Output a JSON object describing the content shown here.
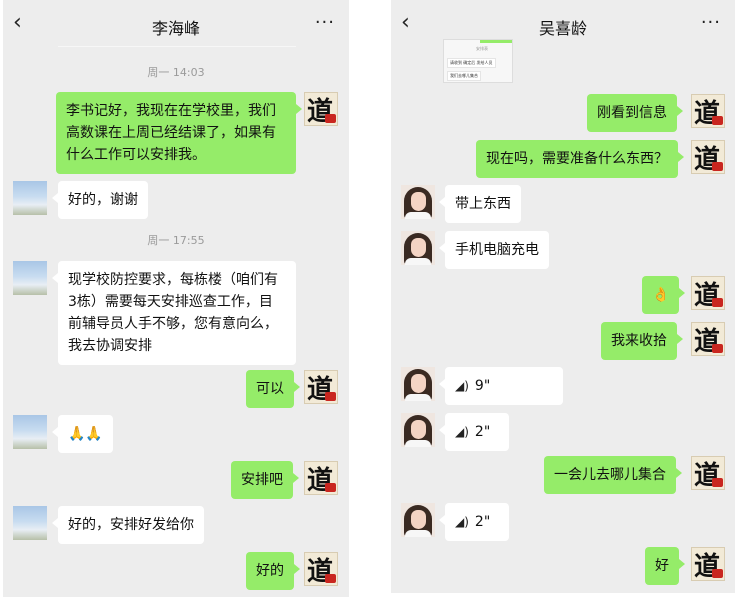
{
  "left_chat": {
    "title": "李海峰",
    "back_icon": "chevron-left-icon",
    "more_icon": "more-dots-icon",
    "messages": [
      {
        "type": "time",
        "text": "周一 14:03"
      },
      {
        "type": "me",
        "text": "李书记好，我现在在学校里，我们高数课在上周已经结课了，如果有什么工作可以安排我。"
      },
      {
        "type": "them",
        "text": "好的，谢谢"
      },
      {
        "type": "time",
        "text": "周一 17:55"
      },
      {
        "type": "them",
        "text": "现学校防控要求，每栋楼（咱们有3栋）需要每天安排巡查工作，目前辅导员人手不够，您有意向么，我去协调安排"
      },
      {
        "type": "me",
        "text": "可以"
      },
      {
        "type": "them",
        "text": "🙏🙏"
      },
      {
        "type": "me",
        "text": "安排吧"
      },
      {
        "type": "them",
        "text": "好的，安排好发给你"
      },
      {
        "type": "me",
        "text": "好的"
      }
    ]
  },
  "right_chat": {
    "title": "吴喜龄",
    "back_icon": "chevron-left-icon",
    "more_icon": "more-dots-icon",
    "screenshot_thumb": {
      "header": "安排表",
      "line1": "请收到 确定后 发给人员",
      "line2": "我们去哪儿集合"
    },
    "messages": [
      {
        "type": "me",
        "text": "刚看到信息"
      },
      {
        "type": "me",
        "text": "现在吗，需要准备什么东西？"
      },
      {
        "type": "them",
        "text": "带上东西"
      },
      {
        "type": "them",
        "text": "手机电脑充电"
      },
      {
        "type": "me",
        "text": "👌"
      },
      {
        "type": "me",
        "text": "我来收拾"
      },
      {
        "type": "them_voice",
        "text": "9\""
      },
      {
        "type": "them_voice",
        "text": "2\""
      },
      {
        "type": "me",
        "text": "一会儿去哪儿集合"
      },
      {
        "type": "them_voice",
        "text": "2\""
      },
      {
        "type": "me",
        "text": "好"
      }
    ]
  },
  "colors": {
    "me_bubble": "#95ec69",
    "them_bubble": "#ffffff",
    "background": "#ededed"
  }
}
